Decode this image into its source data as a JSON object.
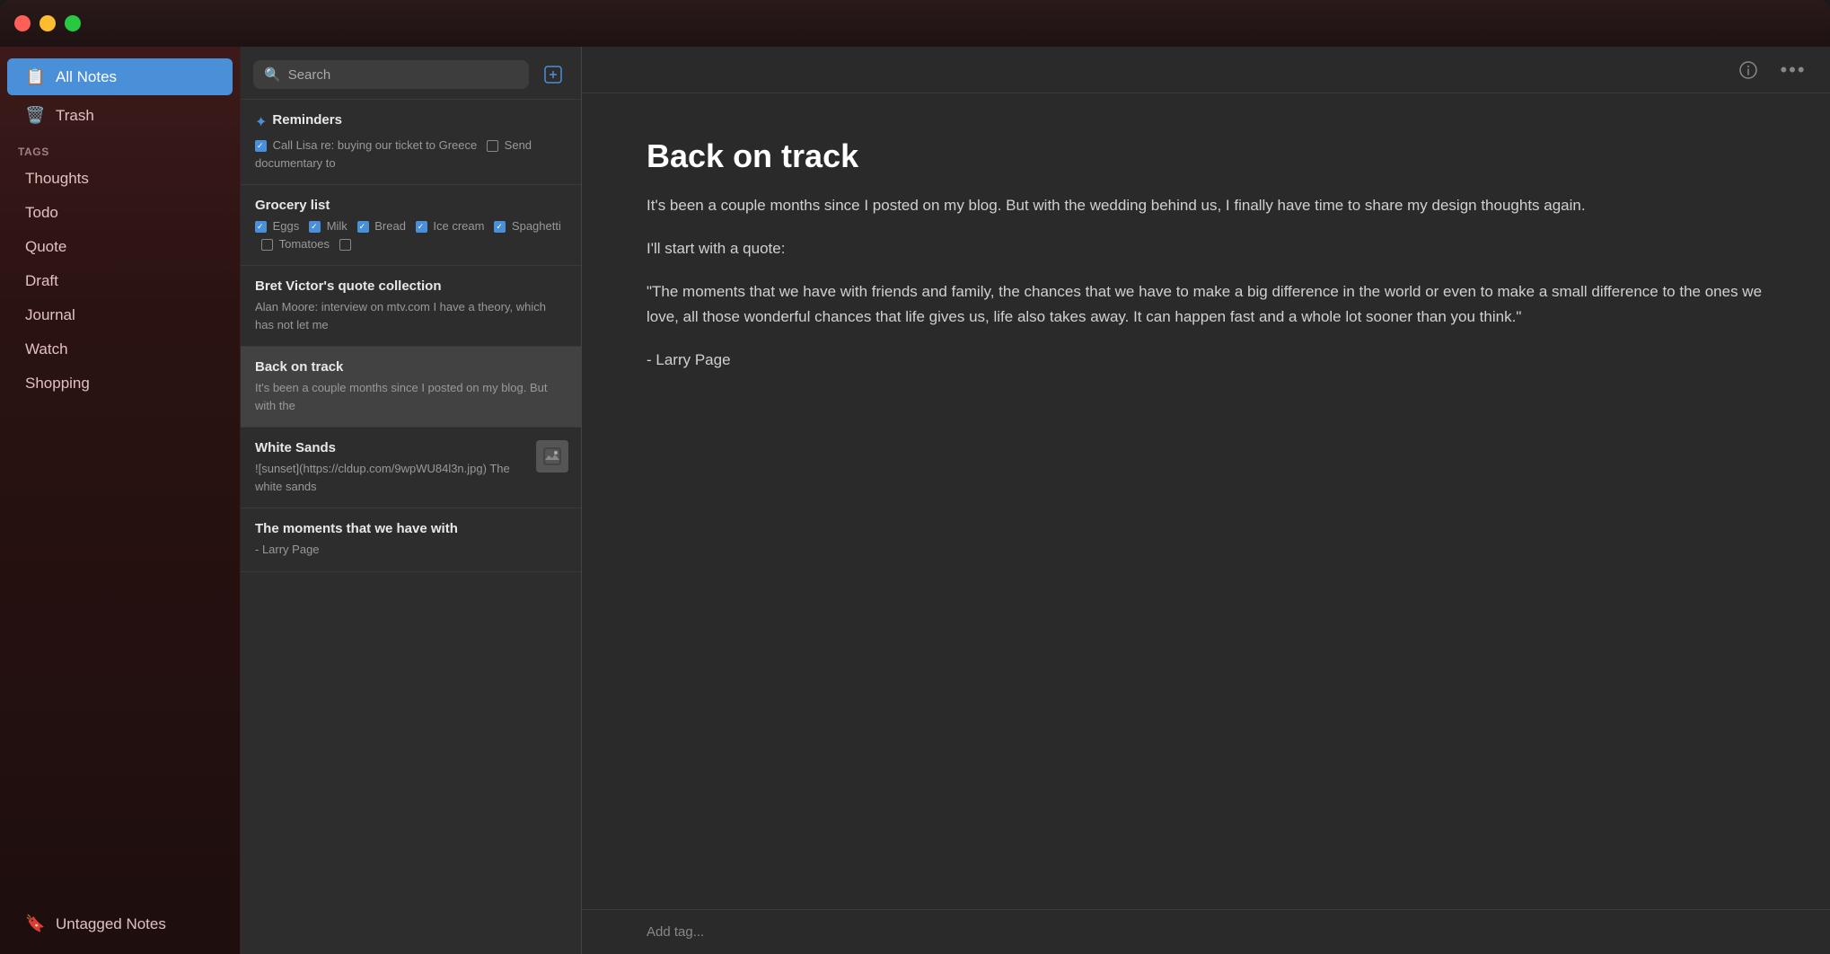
{
  "titlebar": {
    "traffic_lights": [
      "close",
      "minimize",
      "maximize"
    ]
  },
  "sidebar": {
    "top_items": [
      {
        "id": "all-notes",
        "label": "All Notes",
        "icon": "📋",
        "active": true
      },
      {
        "id": "trash",
        "label": "Trash",
        "icon": "🗑️",
        "active": false
      }
    ],
    "tags_label": "TAGS",
    "tag_items": [
      {
        "id": "thoughts",
        "label": "Thoughts"
      },
      {
        "id": "todo",
        "label": "Todo"
      },
      {
        "id": "quote",
        "label": "Quote"
      },
      {
        "id": "draft",
        "label": "Draft"
      },
      {
        "id": "journal",
        "label": "Journal"
      },
      {
        "id": "watch",
        "label": "Watch"
      },
      {
        "id": "shopping",
        "label": "Shopping"
      }
    ],
    "bottom_items": [
      {
        "id": "untagged",
        "label": "Untagged Notes",
        "icon": "🔖"
      }
    ]
  },
  "notes_panel": {
    "search_placeholder": "Search",
    "new_note_icon": "⊞",
    "notes": [
      {
        "id": "reminders",
        "title": "Reminders",
        "preview": "☑ Call Lisa re: buying our ticket to Greece  ☐ Send documentary to",
        "pinned": true,
        "has_thumbnail": false
      },
      {
        "id": "grocery-list",
        "title": "Grocery list",
        "preview": "☑ Eggs  ☑ Milk  ☑ Bread  ☑ Ice cream  ☑ Spaghetti  ☐ Tomatoes  ☐",
        "pinned": false,
        "has_thumbnail": false
      },
      {
        "id": "bret-victor",
        "title": "Bret Victor's quote collection",
        "preview": "Alan Moore: interview on mtv.com  I have a theory, which has not let me",
        "pinned": false,
        "has_thumbnail": false
      },
      {
        "id": "back-on-track",
        "title": "Back on track",
        "preview": "It's been a couple months since I posted on my blog. But with the",
        "pinned": false,
        "active": true,
        "has_thumbnail": false
      },
      {
        "id": "white-sands",
        "title": "White Sands",
        "preview": "![sunset](https://cldup.com/9wpWU84l3n.jpg) The white sands",
        "pinned": false,
        "has_thumbnail": true
      },
      {
        "id": "the-moments",
        "title": "The moments that we have with",
        "preview": "- Larry Page",
        "pinned": false,
        "has_thumbnail": false
      }
    ]
  },
  "editor": {
    "title": "Back on track",
    "paragraphs": [
      "It's been a couple months since I posted on my blog. But with the wedding behind us, I finally have time to share my design thoughts again.",
      "I'll start with a quote:",
      "\"The moments that we have with friends and family, the chances that we have to make a big difference in the world or even to make a small difference to the ones we love, all those wonderful chances that life gives us, life also takes away. It can happen fast and a whole lot sooner than you think.\"",
      "- Larry Page"
    ],
    "add_tag_placeholder": "Add tag..."
  },
  "toolbar": {
    "info_icon": "ℹ",
    "more_icon": "···"
  }
}
